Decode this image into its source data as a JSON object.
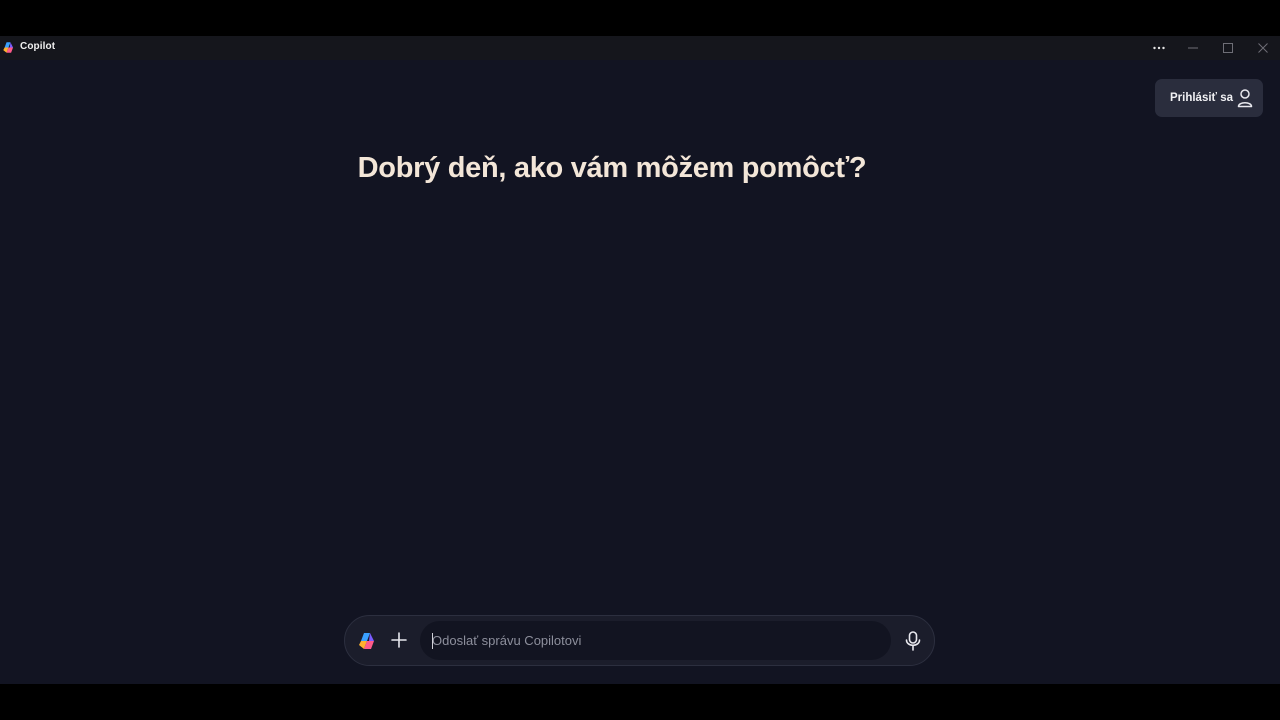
{
  "window": {
    "title": "Copilot",
    "logo_icon": "copilot-logo-icon",
    "controls": [
      "more-options-icon",
      "minimize-icon",
      "maximize-icon",
      "close-icon"
    ]
  },
  "header": {
    "signin_label": "Prihlásiť sa",
    "signin_icon": "user-icon"
  },
  "main": {
    "greeting": "Dobrý deň, ako vám môžem pomôcť?"
  },
  "composer": {
    "placeholder": "Odoslať správu Copilotovi",
    "value": "",
    "icons": [
      "copilot-logo-icon",
      "plus-icon",
      "microphone-icon"
    ]
  },
  "colors": {
    "background": "#121422",
    "greeting_text": "#f3e6d8",
    "signin_button": "#2a2d3d",
    "composer_bg": "#1b1d2b"
  }
}
